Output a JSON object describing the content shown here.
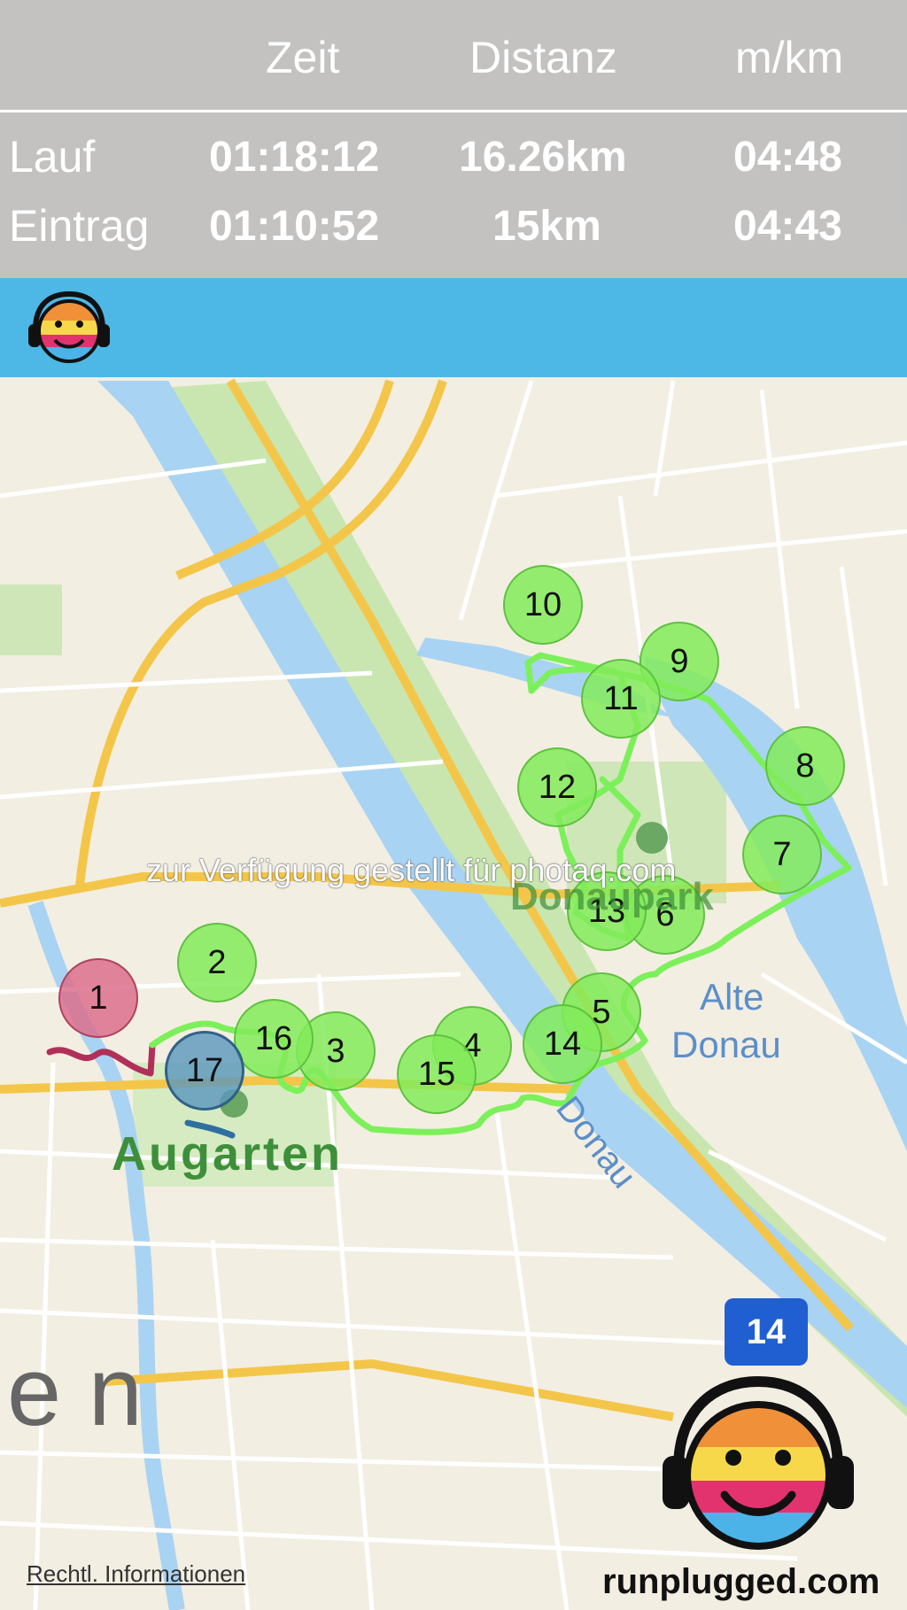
{
  "stats": {
    "headers": {
      "time": "Zeit",
      "distance": "Distanz",
      "pace": "m/km"
    },
    "rows": [
      {
        "label": "Lauf",
        "time": "01:18:12",
        "distance": "16.26km",
        "pace": "04:48"
      },
      {
        "label": "Eintrag",
        "time": "01:10:52",
        "distance": "15km",
        "pace": "04:43"
      }
    ]
  },
  "map": {
    "markers": [
      {
        "id": "1",
        "color": "red"
      },
      {
        "id": "2",
        "color": "green"
      },
      {
        "id": "3",
        "color": "green"
      },
      {
        "id": "4",
        "color": "green"
      },
      {
        "id": "5",
        "color": "green"
      },
      {
        "id": "6",
        "color": "green"
      },
      {
        "id": "7",
        "color": "green"
      },
      {
        "id": "8",
        "color": "green"
      },
      {
        "id": "9",
        "color": "green"
      },
      {
        "id": "10",
        "color": "green"
      },
      {
        "id": "11",
        "color": "green"
      },
      {
        "id": "12",
        "color": "green"
      },
      {
        "id": "13",
        "color": "green"
      },
      {
        "id": "14",
        "color": "green"
      },
      {
        "id": "15",
        "color": "green"
      },
      {
        "id": "16",
        "color": "green"
      },
      {
        "id": "17",
        "color": "blue"
      }
    ],
    "labels": {
      "augarten": "Augarten",
      "donaupark": "Donaupark",
      "alte_donau_1": "Alte",
      "alte_donau_2": "Donau",
      "donau": "Donau",
      "wien_partial": "e n"
    },
    "road_badge": "14",
    "legal": "Rechtl. Informationen"
  },
  "watermark": "zur Verfügung gestellt für photaq.com",
  "brand": "runplugged.com",
  "colors": {
    "route": "#7cf05a",
    "start_route": "#b0305a",
    "end_route": "#2e6fa0",
    "appbar": "#4db8e6",
    "water": "#a9d3f2",
    "park": "#c9e6b0"
  }
}
